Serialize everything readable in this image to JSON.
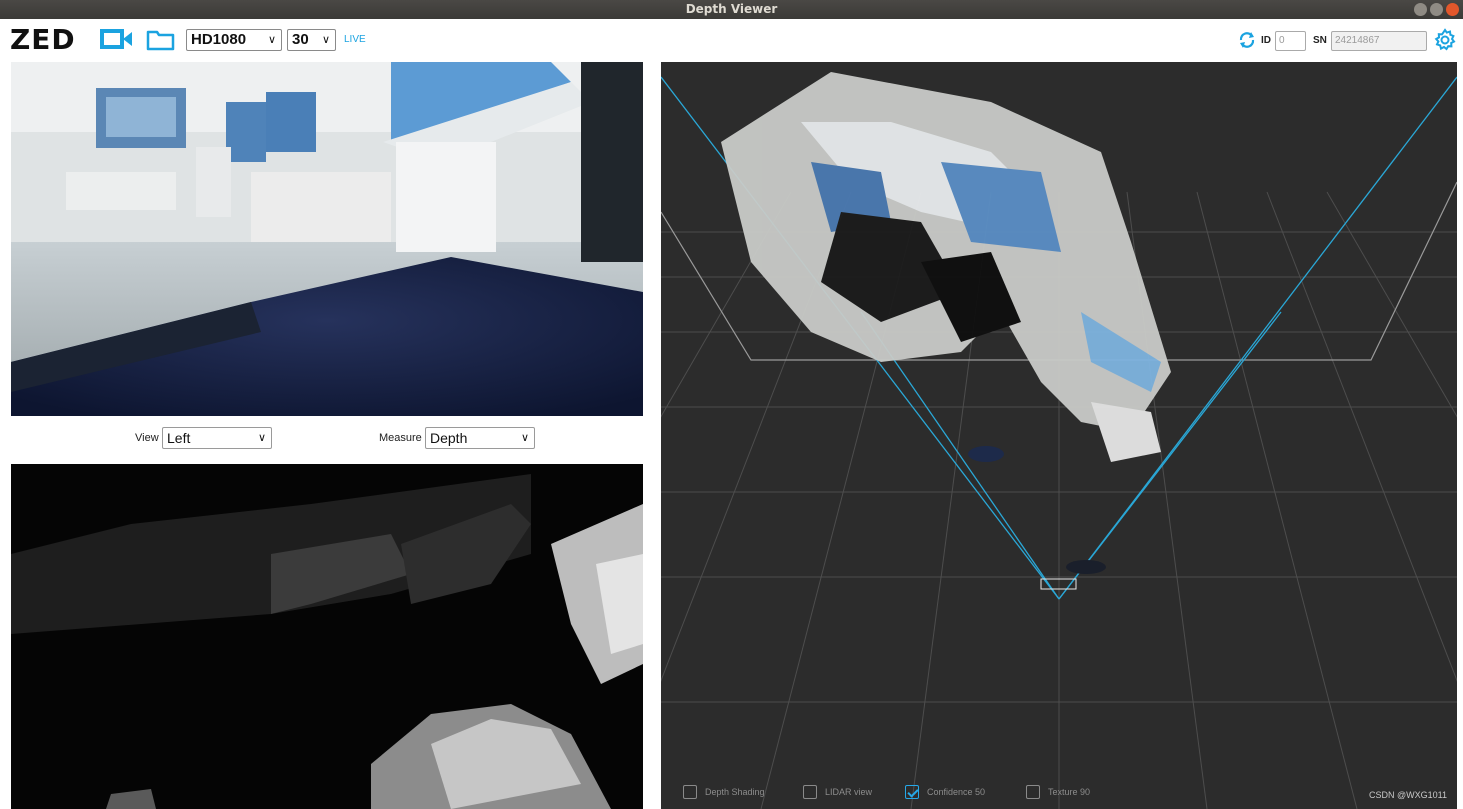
{
  "window": {
    "title": "Depth Viewer"
  },
  "toolbar": {
    "logo": "ZED",
    "camera_icon": "video-camera-icon",
    "folder_icon": "folder-icon",
    "resolution": "HD1080",
    "fps": "30",
    "mode": "LIVE",
    "refresh_icon": "refresh-icon",
    "id_label": "ID",
    "id_placeholder": "0",
    "sn_label": "SN",
    "sn_value": "24214867",
    "settings_icon": "gear-icon"
  },
  "controls": {
    "view_label": "View",
    "view_value": "Left",
    "measure_label": "Measure",
    "measure_value": "Depth"
  },
  "viewer_options": [
    {
      "label": "Depth Shading",
      "checked": false
    },
    {
      "label": "LIDAR view",
      "checked": false
    },
    {
      "label": "Confidence 50",
      "checked": true
    },
    {
      "label": "Texture 90",
      "checked": false
    }
  ],
  "watermark": "CSDN @WXG1011",
  "colors": {
    "accent": "#1ba3e0",
    "viewer_bg": "#2c2c2c",
    "frustum": "#2aa7d6"
  }
}
